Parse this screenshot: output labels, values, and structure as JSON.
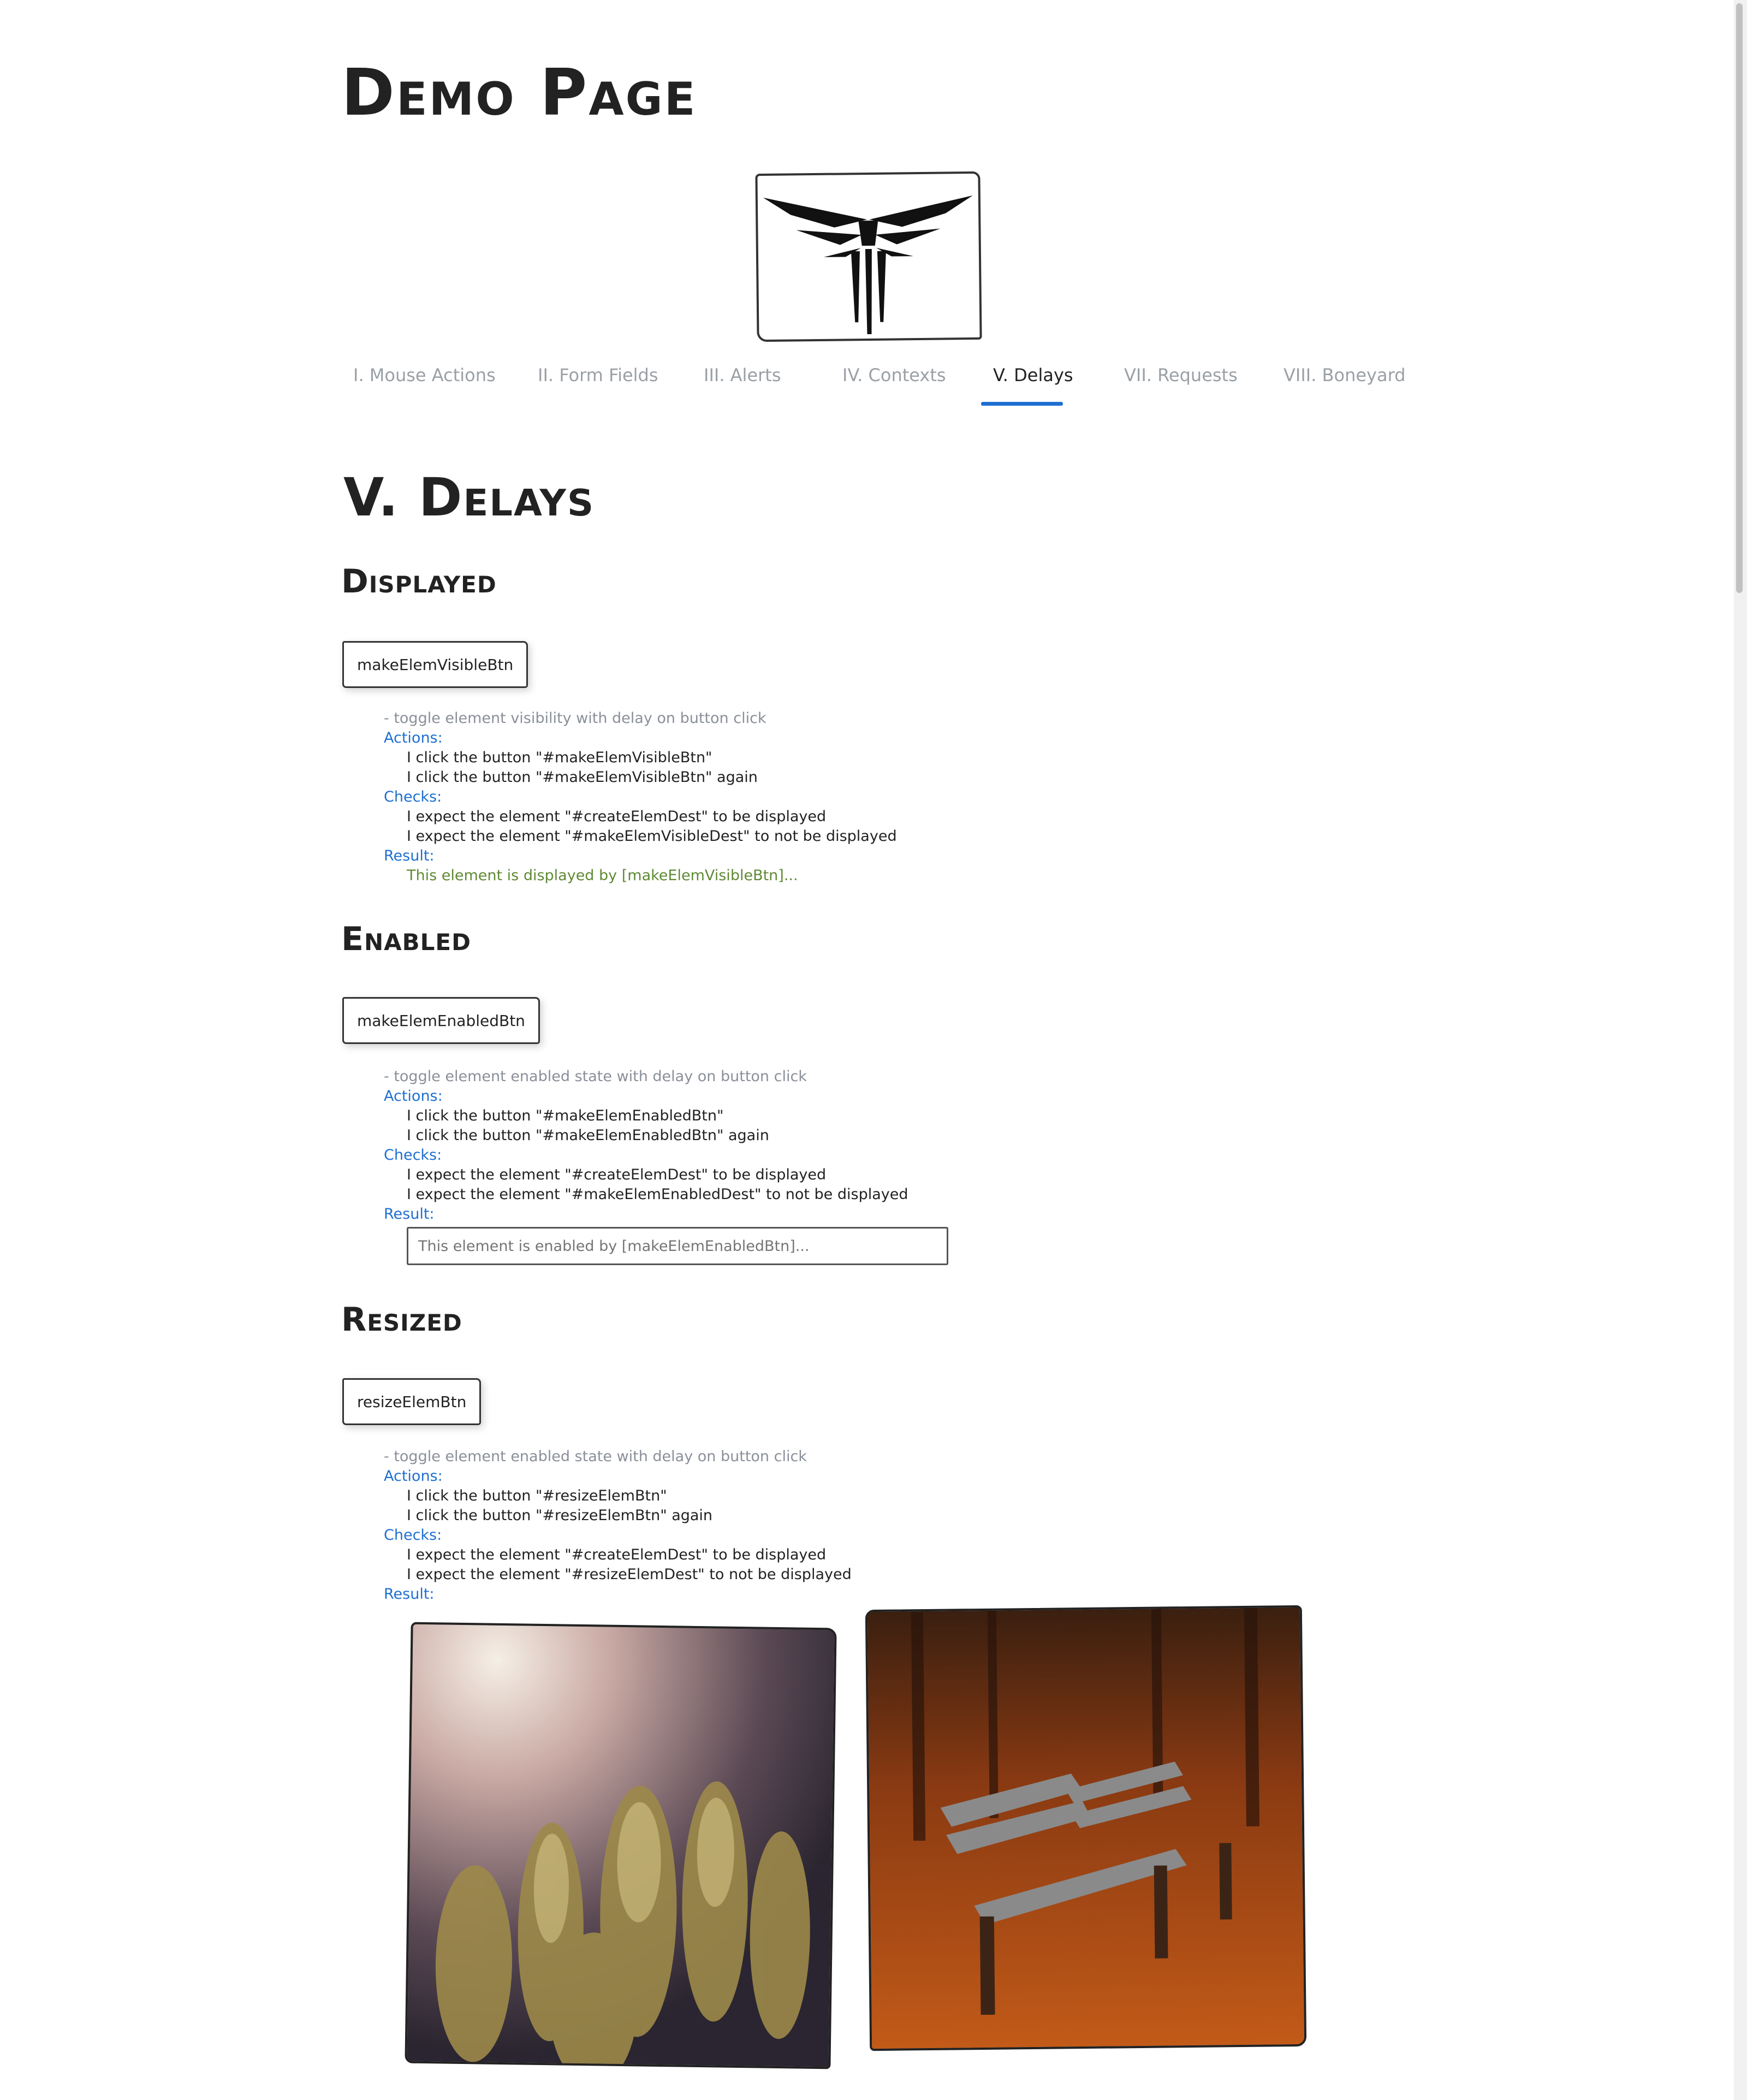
{
  "page": {
    "title": "Demo Page"
  },
  "nav": {
    "tabs": [
      {
        "label": "I. Mouse Actions",
        "active": false
      },
      {
        "label": "II. Form Fields",
        "active": false
      },
      {
        "label": "III. Alerts",
        "active": false
      },
      {
        "label": "IV. Contexts",
        "active": false
      },
      {
        "label": "V. Delays",
        "active": true
      },
      {
        "label": "VII. Requests",
        "active": false
      },
      {
        "label": "VIII. Boneyard",
        "active": false
      }
    ]
  },
  "section": {
    "title": "V. Delays"
  },
  "displayed": {
    "title": "Displayed",
    "button_label": "makeElemVisibleBtn",
    "note": "- toggle element visibility with delay on button click",
    "actions_label": "Actions:",
    "actions": [
      "I click the button \"#makeElemVisibleBtn\"",
      "I click the button \"#makeElemVisibleBtn\" again"
    ],
    "checks_label": "Checks:",
    "checks": [
      "I expect the element \"#createElemDest\" to be displayed",
      "I expect the element \"#makeElemVisibleDest\" to not be displayed"
    ],
    "result_label": "Result:",
    "result_text": "This element is displayed by [makeElemVisibleBtn]..."
  },
  "enabled": {
    "title": "Enabled",
    "button_label": "makeElemEnabledBtn",
    "note": "- toggle element enabled state with delay on button click",
    "actions_label": "Actions:",
    "actions": [
      "I click the button \"#makeElemEnabledBtn\"",
      "I click the button \"#makeElemEnabledBtn\" again"
    ],
    "checks_label": "Checks:",
    "checks": [
      "I expect the element \"#createElemDest\" to be displayed",
      "I expect the element \"#makeElemEnabledDest\" to not be displayed"
    ],
    "result_label": "Result:",
    "result_placeholder": "This element is enabled by [makeElemEnabledBtn]..."
  },
  "resized": {
    "title": "Resized",
    "button_label": "resizeElemBtn",
    "note": "- toggle element enabled state with delay on button click",
    "actions_label": "Actions:",
    "actions": [
      "I click the button \"#resizeElemBtn\"",
      "I click the button \"#resizeElemBtn\" again"
    ],
    "checks_label": "Checks:",
    "checks": [
      "I expect the element \"#createElemDest\" to be displayed",
      "I expect the element \"#resizeElemDest\" to not be displayed"
    ],
    "result_label": "Result:",
    "images": [
      "cactus-photo",
      "park-bench-photo"
    ]
  },
  "colors": {
    "accent": "#1e6fd0",
    "result_green": "#5f8a34",
    "muted": "#8a8f99"
  }
}
